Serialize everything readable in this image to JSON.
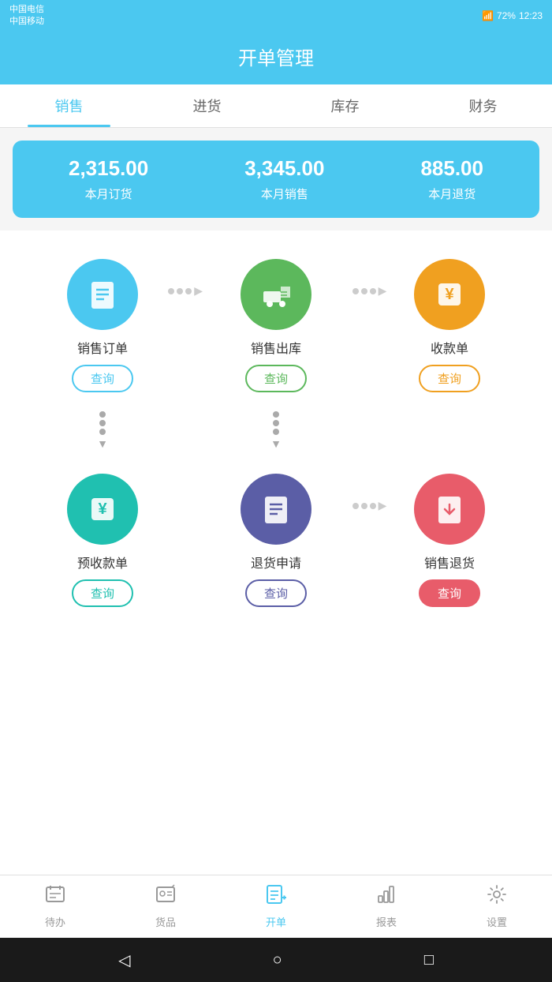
{
  "statusBar": {
    "leftLine1": "中国电信",
    "leftLine2": "中国移动",
    "signal": "46 26",
    "battery": "72%",
    "time": "12:23"
  },
  "header": {
    "title": "开单管理"
  },
  "tabs": [
    {
      "label": "销售",
      "active": true
    },
    {
      "label": "进货",
      "active": false
    },
    {
      "label": "库存",
      "active": false
    },
    {
      "label": "财务",
      "active": false
    }
  ],
  "stats": [
    {
      "value": "2,315.00",
      "label": "本月订货"
    },
    {
      "value": "3,345.00",
      "label": "本月销售"
    },
    {
      "value": "885.00",
      "label": "本月退货"
    }
  ],
  "row1": [
    {
      "id": "sales-order",
      "label": "销售订单",
      "queryLabel": "查询",
      "colorClass": "circle-blue",
      "queryClass": "blue"
    },
    {
      "id": "sales-outbound",
      "label": "销售出库",
      "queryLabel": "查询",
      "colorClass": "circle-green",
      "queryClass": "green"
    },
    {
      "id": "receipt",
      "label": "收款单",
      "queryLabel": "查询",
      "colorClass": "circle-orange",
      "queryClass": "orange"
    }
  ],
  "row2": [
    {
      "id": "advance-receipt",
      "label": "预收款单",
      "queryLabel": "查询",
      "colorClass": "circle-teal",
      "queryClass": "teal"
    },
    {
      "id": "return-apply",
      "label": "退货申请",
      "queryLabel": "查询",
      "colorClass": "circle-purple",
      "queryClass": "purple"
    },
    {
      "id": "sales-return",
      "label": "销售退货",
      "queryLabel": "查询",
      "colorClass": "circle-red",
      "queryClass": "red"
    }
  ],
  "bottomNav": [
    {
      "id": "todo",
      "label": "待办",
      "active": false
    },
    {
      "id": "goods",
      "label": "货品",
      "active": false
    },
    {
      "id": "order",
      "label": "开单",
      "active": true
    },
    {
      "id": "report",
      "label": "报表",
      "active": false
    },
    {
      "id": "settings",
      "label": "设置",
      "active": false
    }
  ],
  "androidNav": {
    "back": "◁",
    "home": "○",
    "recent": "□"
  }
}
